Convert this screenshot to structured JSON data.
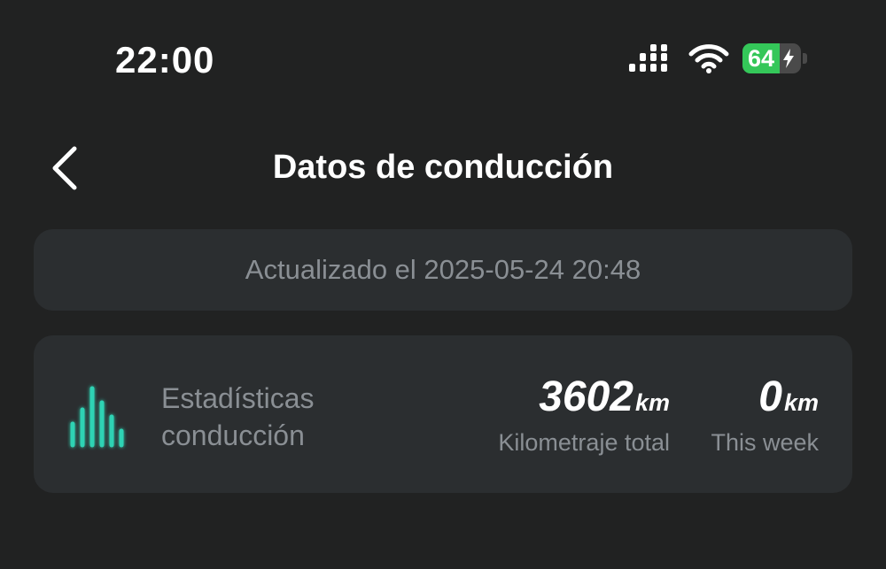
{
  "status_bar": {
    "time": "22:00",
    "battery_level": "64",
    "battery_fill_fraction": 0.64,
    "charging": true,
    "icons": [
      "cell-signal-icon",
      "wifi-icon",
      "battery-charging-icon"
    ]
  },
  "header": {
    "back_icon": "chevron-left-icon",
    "title": "Datos de conducción"
  },
  "updated": {
    "text": "Actualizado el 2025-05-24 20:48"
  },
  "stats": {
    "icon": "bar-chart-icon",
    "label_line1": "Estadísticas",
    "label_line2": "conducción",
    "total": {
      "value": "3602",
      "unit": "km",
      "label": "Kilometraje total"
    },
    "week": {
      "value": "0",
      "unit": "km",
      "label": "This week"
    }
  },
  "colors": {
    "background": "#212222",
    "card": "#2b2e30",
    "muted_text": "#8a8f94",
    "accent": "#2fd3b4",
    "battery_green": "#34c759"
  }
}
